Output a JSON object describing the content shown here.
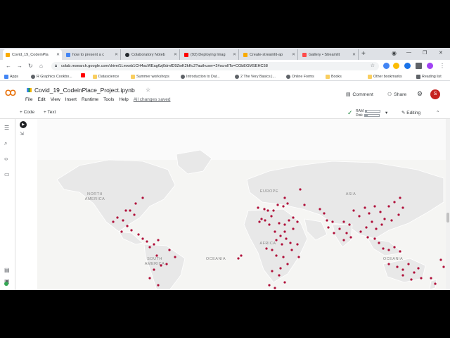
{
  "browser": {
    "tabs": [
      {
        "label": "Covid_19_CodeinPla",
        "favicon_color": "#f9ab00"
      },
      {
        "label": "how to present a c",
        "favicon_color": "#4285f4"
      },
      {
        "label": "Colaboratory Noteb",
        "favicon_color": "#24292e"
      },
      {
        "label": "(93) Deploying Imag",
        "favicon_color": "#ff0000"
      },
      {
        "label": "Create-streamlit-ap",
        "favicon_color": "#f9ab00"
      },
      {
        "label": "Gallery • Streamlit",
        "favicon_color": "#ff4b4b"
      }
    ],
    "url": "colab.research.google.com/drive/1Lmxeb1CH4acWEag6zj0dmfD9ZwK2kKc2?authuser=2#scrollTo=CGbEGMSEHC58",
    "bookmarks": [
      {
        "label": "Apps",
        "color": "#4285f4"
      },
      {
        "label": "R Graphics Cookbo...",
        "color": "#5f6368"
      },
      {
        "label": "",
        "color": "#ff0000"
      },
      {
        "label": "Datascience",
        "color": "#f9ce60"
      },
      {
        "label": "Summer workshops",
        "color": "#f9ce60"
      },
      {
        "label": "Introduction to Dat...",
        "color": "#5f6368"
      },
      {
        "label": "2 The Very Basics |...",
        "color": "#5f6368"
      },
      {
        "label": "Online Forms",
        "color": "#5f6368"
      },
      {
        "label": "Books",
        "color": "#f9ce60"
      },
      {
        "label": "Other bookmarks",
        "color": "#f9ce60"
      },
      {
        "label": "Reading list",
        "color": "#5f6368"
      }
    ]
  },
  "colab": {
    "logo": "CO",
    "notebook_title": "Covid_19_CodeinPlace_Project.ipynb",
    "menu": [
      "File",
      "Edit",
      "View",
      "Insert",
      "Runtime",
      "Tools",
      "Help"
    ],
    "save_status": "All changes saved",
    "comment_label": "Comment",
    "share_label": "Share",
    "avatar_letter": "S",
    "add_code_label": "+ Code",
    "add_text_label": "+ Text",
    "ram_label": "RAM",
    "disk_label": "Disk",
    "ram_fraction": 0.1,
    "disk_fraction": 0.2,
    "editing_label": "Editing"
  },
  "map": {
    "labels": {
      "north_america": "NORTH\nAMERICA",
      "south_america": "SOUTH\nAMERICA",
      "europe": "EUROPE",
      "asia": "ASIA",
      "africa": "AFRICA",
      "oceania_left": "OCEANIA",
      "oceania_right": "OCEANIA"
    },
    "dot_color": "#b0103a",
    "land_color": "#e8e8e8",
    "water_color": "#f5f5f3"
  }
}
